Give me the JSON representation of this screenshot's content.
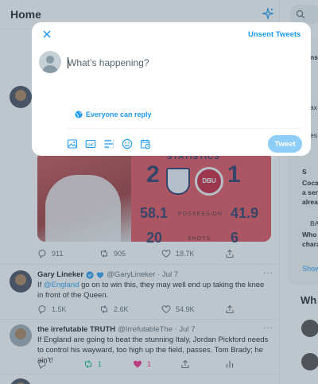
{
  "header": {
    "title": "Home"
  },
  "compose": {
    "unsent_label": "Unsent Tweets",
    "placeholder": "What’s happening?",
    "reply_setting": "Everyone can reply",
    "tweet_button": "Tweet",
    "toolbar_icons": [
      "image-icon",
      "gif-icon",
      "poll-icon",
      "emoji-icon",
      "schedule-icon"
    ]
  },
  "media_stats": {
    "heading": "STATISTICS",
    "eng_goals": "2",
    "den_goals": "1",
    "eng_possession": "58.1",
    "den_possession": "41.9",
    "possession_label": "POSSESSION",
    "eng_shots": "20",
    "den_shots": "6",
    "shots_label": "SHOTS",
    "den_badge": "DBU"
  },
  "tweets": [
    {
      "replies": "911",
      "retweets": "905",
      "likes": "18.7K"
    },
    {
      "name": "Gary Lineker",
      "handle": "@GaryLineker · Jul 7",
      "text_prefix": "If ",
      "mention": "@England",
      "text_rest": " go on to win this, they may well end up taking the knee in front of the Queen.",
      "replies": "1.5K",
      "retweets": "2.6K",
      "likes": "54.9K"
    },
    {
      "name": "the irrefutable TRUTH",
      "handle": "@IrrefutableThe · Jul 7",
      "text": "If England are going to beat the stunning Italy, Jordan Pickford needs to control his wayward, too high up the field, passes. Tom Brady; he ain't!",
      "replies": "",
      "retweets": "1",
      "likes": "1"
    }
  ],
  "sidebar": {
    "fragments": [
      "ns",
      "ax",
      "es",
      "Cocal",
      "a ser",
      "alrea",
      "BA",
      "Who",
      "chara"
    ],
    "marker": "S",
    "show_more": "Show",
    "section_heading": "Wh"
  },
  "colors": {
    "accent": "#1d9bf0",
    "tweet_button_disabled": "#8ecdf8",
    "retweet_green": "#00ba7c",
    "like_pink": "#f91880"
  }
}
